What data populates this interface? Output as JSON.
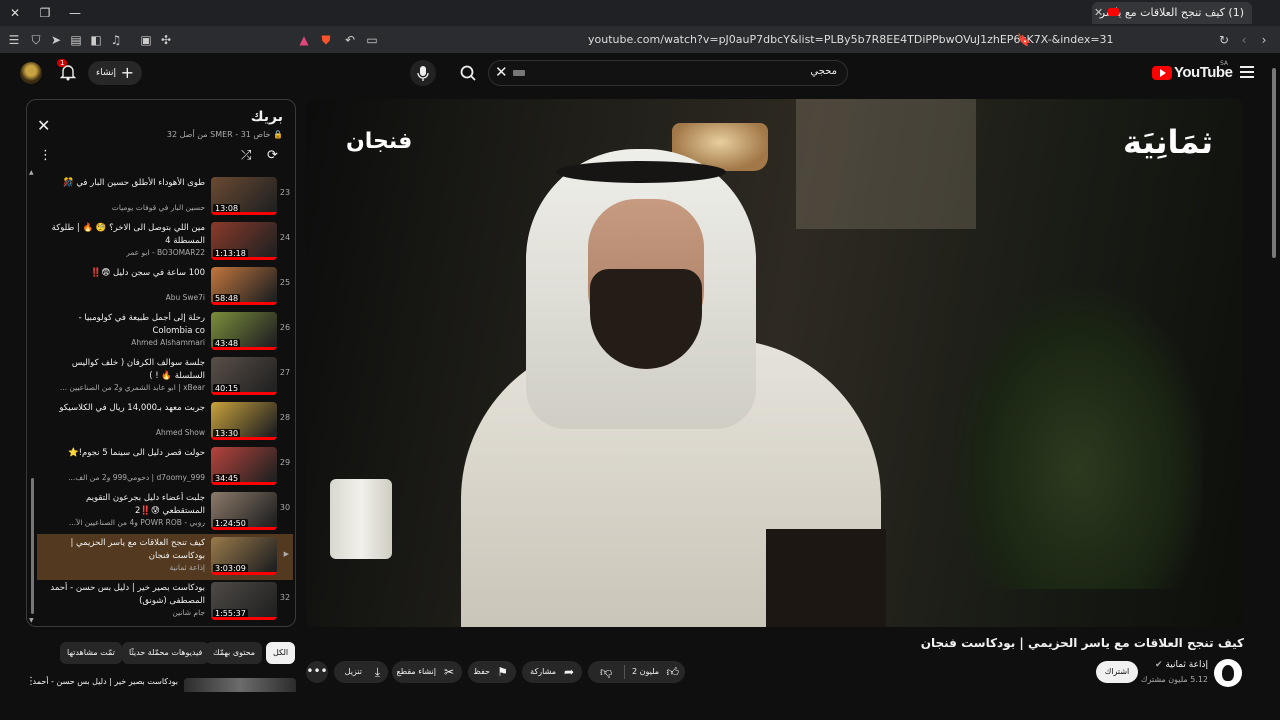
{
  "browser": {
    "tab_title": "(1) كيف تنجح العلاقات مع ياسر",
    "url": "youtube.com/watch?v=pJ0auP7dbcY&list=PLBy5b7R8EE4TDiPPbwOVuJ1zhEP6cK7X-&index=31"
  },
  "header": {
    "logo_text": "YouTube",
    "logo_country": "SA",
    "search_term": "محجي",
    "create_label": "إنشاء",
    "notification_count": "1"
  },
  "playlist": {
    "title": "بريك",
    "subtitle": "خاص SMER - 31 من أصل 32",
    "items": [
      {
        "num": "23",
        "title": "طوى الأهوداء الأطلق حسين البار في 🎊",
        "channel": "حسين البار في قوفات يوميات",
        "duration": "13:08",
        "thumb": "#6b4a32"
      },
      {
        "num": "24",
        "title": "مين اللي بتوصل الى الاخر؟ 🧐 🔥 | طلوكة المسطلة 4",
        "channel": "BO3OMAR22 - ابو عمر",
        "duration": "1:13:18",
        "thumb": "#8b3a2a"
      },
      {
        "num": "25",
        "title": "100 ساعة في سجن دليل 😨‼️",
        "channel": "Abu Swe7i",
        "duration": "58:48",
        "thumb": "#c2763d"
      },
      {
        "num": "26",
        "title": "رحلة إلى أجمل طبيعة في كولومبيا - Colombia co",
        "channel": "Ahmed Alshammari",
        "duration": "43:48",
        "thumb": "#7b8f3a"
      },
      {
        "num": "27",
        "title": "جلسة سوالف الكرفان ( خلف كواليس السلسلة 🔥 ! )",
        "channel": "xBear | ابو عابد الشمري و2 من الصناعيين ...",
        "duration": "40:15",
        "thumb": "#5a4f48"
      },
      {
        "num": "28",
        "title": "جربت معهد بـ14,000 ريال في الكلاسيكو",
        "channel": "Ahmed Show",
        "duration": "13:30",
        "thumb": "#c9a23b"
      },
      {
        "num": "29",
        "title": "حولت قصر دليل الى سينما 5 نجوم!⭐",
        "channel": "d7oomy_999 | دحومي999 و2 من الف...",
        "duration": "34:45",
        "thumb": "#b8433c"
      },
      {
        "num": "30",
        "title": "جلبت أعضاء دليل بجرعون التقويم المستقطعي 😰‼️2",
        "channel": "روبي - POWR ROB و4 من الصناعيين الآ...",
        "duration": "1:24:50",
        "thumb": "#8c7a6a"
      },
      {
        "num": "",
        "title": "كيف تنجح العلاقات مع ياسر الحزيمي | بودكاست فنجان",
        "channel": "إذاعة ثمانية",
        "duration": "3:03:09",
        "thumb": "#9a7a4a",
        "playing_icon": "▶"
      },
      {
        "num": "32",
        "title": "بودكاست بصير خير | دليل بس حسن - أحمد المصطفى (شونق)",
        "channel": "جام شانين",
        "duration": "1:55:37",
        "thumb": "#4e4a46"
      }
    ]
  },
  "video": {
    "watermark_left": "فنجان",
    "watermark_right": "ثمَانِيَة",
    "title": "كيف تنجح العلاقات مع ياسر الحزيمي | بودكاست فنجان",
    "channel_name": "إذاعة ثمانية",
    "channel_verified": "✔",
    "channel_subs": "5.12 مليون مشترك",
    "subscribe_label": "اشتراك",
    "like_count": "2 مليون",
    "share_label": "مشاركة",
    "save_label": "حفظ",
    "clip_label": "إنشاء مقطع",
    "download_label": "تنزيل",
    "more_label": "•••"
  },
  "chips": [
    "الكل",
    "محتوى بهمّك",
    "فيديوهات محمّلة حديثًا",
    "تمّت مشاهدتها"
  ],
  "next_recommendation": {
    "title": "بودكاست بصير خير | دليل بس حسن - أحمد"
  }
}
